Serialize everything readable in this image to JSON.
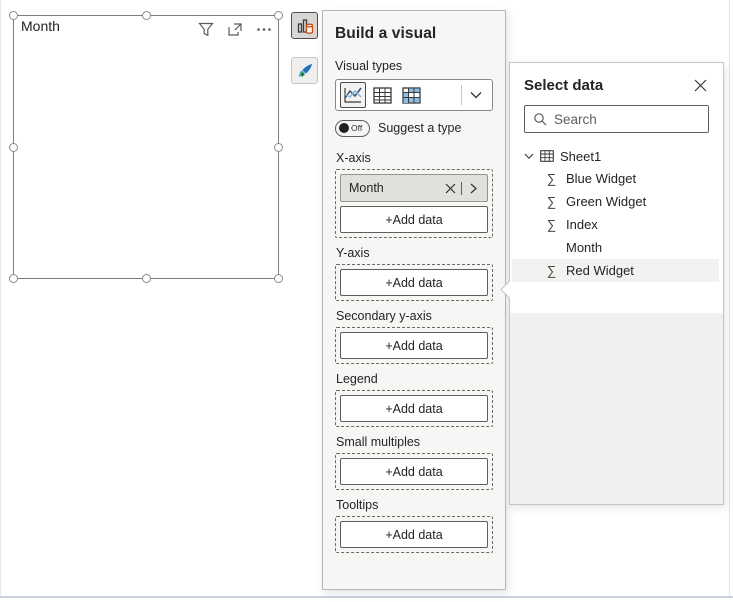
{
  "visual": {
    "title": "Month"
  },
  "build_panel": {
    "title": "Build a visual",
    "visual_types_label": "Visual types",
    "suggest": {
      "state": "Off",
      "label": "Suggest a type"
    },
    "wells": [
      {
        "label": "X-axis",
        "field": "Month",
        "add_label": "+Add data"
      },
      {
        "label": "Y-axis",
        "add_label": "+Add data"
      },
      {
        "label": "Secondary y-axis",
        "add_label": "+Add data"
      },
      {
        "label": "Legend",
        "add_label": "+Add data"
      },
      {
        "label": "Small multiples",
        "add_label": "+Add data"
      },
      {
        "label": "Tooltips",
        "add_label": "+Add data"
      }
    ]
  },
  "select_data": {
    "title": "Select data",
    "search_placeholder": "Search",
    "table_name": "Sheet1",
    "fields": [
      {
        "name": "Blue Widget",
        "aggregated": true
      },
      {
        "name": "Green Widget",
        "aggregated": true
      },
      {
        "name": "Index",
        "aggregated": true
      },
      {
        "name": "Month",
        "aggregated": false
      },
      {
        "name": "Red Widget",
        "aggregated": true,
        "highlighted": true
      }
    ]
  },
  "colors": {
    "accent_orange": "#ca5010",
    "brush_blue": "#2072b8",
    "plus_green": "#107c10",
    "matrix_blue": "#85bfe9",
    "hover_gray": "#f3f2f1",
    "panel_bg": "#f7f6f4"
  }
}
